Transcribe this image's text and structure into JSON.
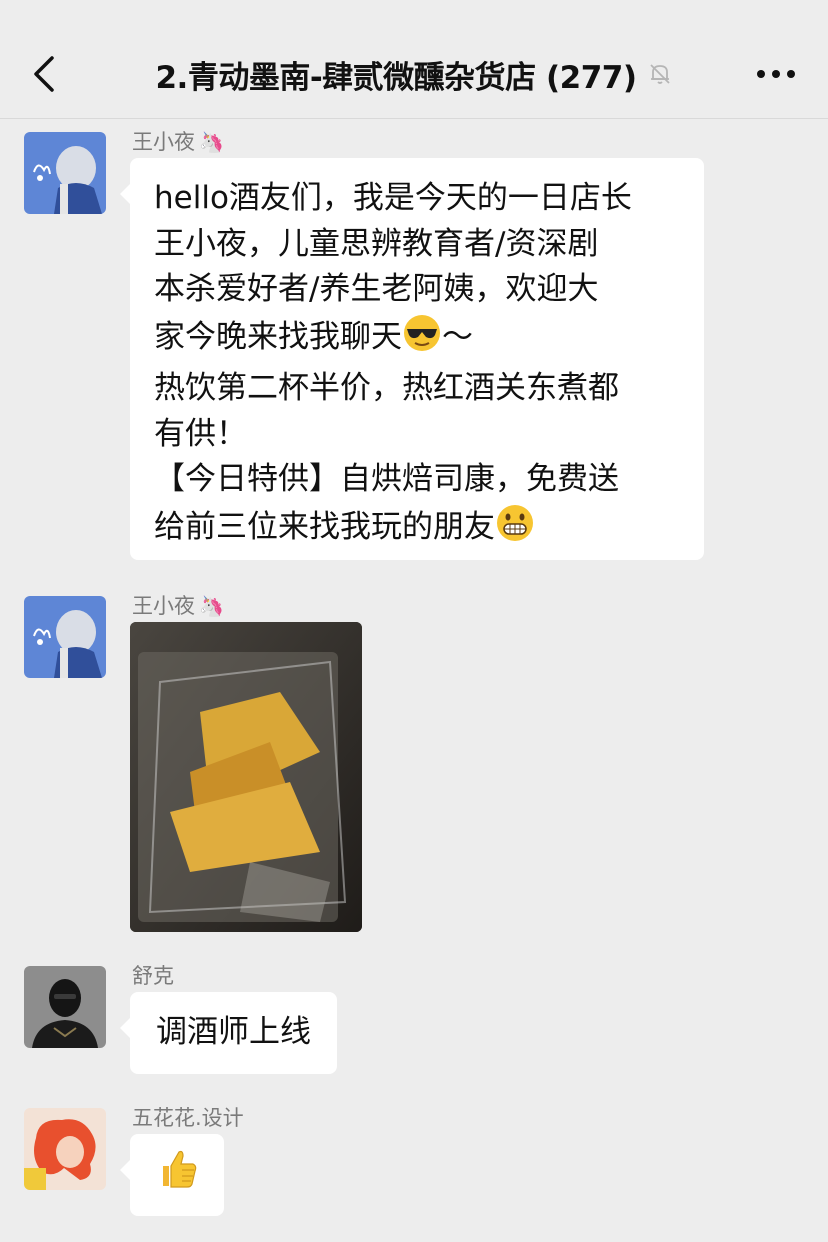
{
  "header": {
    "title": "2.青动墨南-肆贰微醺杂货店 (277)",
    "back_icon": "chevron-left-icon",
    "mute_icon": "bell-muted-icon",
    "more_icon": "ellipsis-icon"
  },
  "messages": [
    {
      "sender": "王小夜",
      "sender_badge": "unicorn-emoji",
      "type": "text",
      "lines": [
        "hello酒友们，我是今天的一日店长",
        "王小夜，儿童思辨教育者/资深剧",
        "本杀爱好者/养生老阿姨，欢迎大",
        "家今晚来找我聊天",
        "热饮第二杯半价，热红酒关东煮都",
        "有供！",
        "【今日特供】自烘焙司康，免费送",
        "给前三位来找我玩的朋友"
      ],
      "line4_suffix": "～",
      "emojis": [
        "sunglasses-emoji",
        "grinning-emoji"
      ]
    },
    {
      "sender": "王小夜",
      "sender_badge": "unicorn-emoji",
      "type": "image",
      "image_subject": "scones-in-plastic-bag-photo"
    },
    {
      "sender": "舒克",
      "type": "text",
      "text": "调酒师上线"
    },
    {
      "sender": "五花花.设计",
      "type": "sticker",
      "sticker": "thumbs-up-emoji"
    }
  ],
  "colors": {
    "background": "#ededed",
    "bubble": "#ffffff",
    "sender_name": "#7a7a7a"
  }
}
